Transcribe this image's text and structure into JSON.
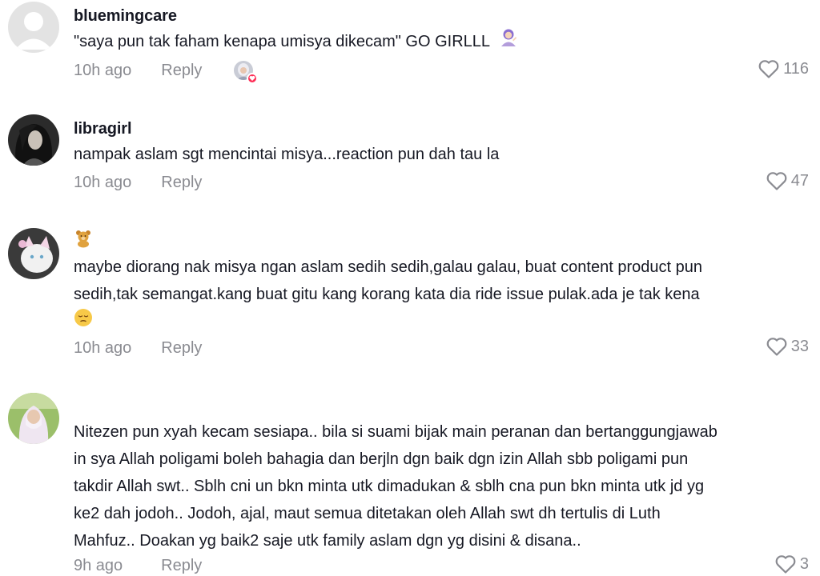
{
  "comments": [
    {
      "username": "bluemingcare",
      "lines": [
        "\"saya pun tak faham kenapa umisya dikecam\" GO GIRLLL"
      ],
      "time": "10h ago",
      "reply": "Reply",
      "likes": "116",
      "liked_by_creator": true
    },
    {
      "username": "libragirl",
      "lines": [
        "nampak aslam sgt mencintai misya...reaction pun dah tau la"
      ],
      "time": "10h ago",
      "reply": "Reply",
      "likes": "47"
    },
    {
      "username": "",
      "lines": [
        "maybe diorang nak misya ngan aslam sedih sedih,galau galau, buat content product pun",
        "sedih,tak semangat.kang buat gitu kang korang kata dia ride issue pulak.ada je tak kena"
      ],
      "time": "10h ago",
      "reply": "Reply",
      "likes": "33"
    },
    {
      "username": "",
      "lines": [
        "Nitezen pun xyah kecam sesiapa.. bila si suami bijak main peranan dan bertanggungjawab",
        "in sya Allah poligami boleh bahagia dan berjln dgn baik dgn izin Allah sbb poligami pun",
        "takdir Allah swt.. Sblh cni un bkn minta utk dimadukan & sblh cna pun bkn minta utk jd yg",
        "ke2 dah jodoh.. Jodoh, ajal, maut semua ditetakan oleh Allah swt dh tertulis di Luth",
        "Mahfuz.. Doakan yg baik2 saje utk family aslam dgn yg disini & disana.."
      ],
      "time": "9h ago",
      "reply": "Reply",
      "likes": "3"
    }
  ],
  "icons": {
    "like": "heart-outline-icon",
    "liked_badge": "heart-badge-icon",
    "emojis": [
      "woman-tipping-hand-emoji",
      "teddy-bear-emoji",
      "pensive-face-emoji"
    ]
  },
  "colors": {
    "text": "#161823",
    "secondary": "#8a8b91",
    "accent": "#fe2c55"
  }
}
